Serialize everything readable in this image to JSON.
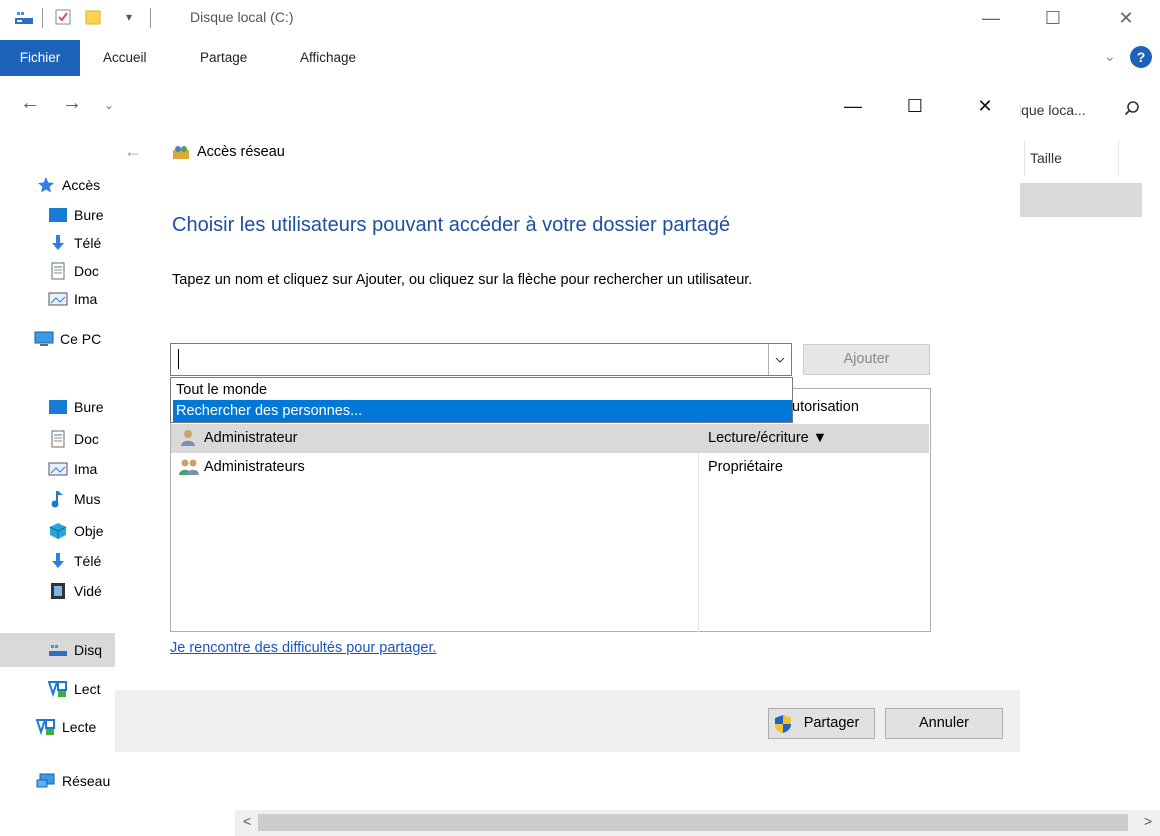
{
  "window": {
    "title": "Disque local (C:)",
    "controls": {
      "minimize": "—",
      "maximize": "☐",
      "close": "✕"
    }
  },
  "ribbon": {
    "tabs": [
      "Fichier",
      "Accueil",
      "Partage",
      "Affichage"
    ],
    "help": "?",
    "expand": "⌄"
  },
  "navbar": {
    "search_text": "ique loca...",
    "back": "←",
    "forward": "→",
    "recent": "⌄"
  },
  "sidebar": {
    "items": [
      {
        "label": "Accès",
        "icon": "star-icon"
      },
      {
        "label": "Bure",
        "icon": "desktop-icon"
      },
      {
        "label": "Télé",
        "icon": "download-icon"
      },
      {
        "label": "Doc",
        "icon": "document-icon"
      },
      {
        "label": "Ima",
        "icon": "pictures-icon"
      },
      {
        "label": "Ce PC",
        "icon": "computer-icon"
      },
      {
        "label": "Bure",
        "icon": "desktop-icon"
      },
      {
        "label": "Doc",
        "icon": "document-icon"
      },
      {
        "label": "Ima",
        "icon": "pictures-icon"
      },
      {
        "label": "Mus",
        "icon": "music-icon"
      },
      {
        "label": "Obje",
        "icon": "3d-objects-icon"
      },
      {
        "label": "Télé",
        "icon": "download-icon"
      },
      {
        "label": "Vidé",
        "icon": "video-icon"
      },
      {
        "label": "Disq",
        "icon": "drive-icon"
      },
      {
        "label": "Lect",
        "icon": "network-drive-icon"
      },
      {
        "label": "Lecte",
        "icon": "network-drive-icon"
      },
      {
        "label": "Réseau",
        "icon": "network-icon"
      }
    ]
  },
  "filelist": {
    "column_size": "Taille"
  },
  "dialog": {
    "title": "Accès réseau",
    "heading": "Choisir les utilisateurs pouvant accéder à votre dossier partagé",
    "instruction": "Tapez un nom et cliquez sur Ajouter, ou cliquez sur la flèche pour rechercher un utilisateur.",
    "input_value": "",
    "add_button": "Ajouter",
    "dropdown_options": [
      "Tout le monde",
      "Rechercher des personnes..."
    ],
    "table": {
      "header_permission_partial": "utorisation",
      "rows": [
        {
          "name": "Administrateur",
          "permission": "Lecture/écriture ▼"
        },
        {
          "name": "Administrateurs",
          "permission": "Propriétaire"
        }
      ]
    },
    "help_link": "Je rencontre des difficultés pour partager.",
    "share_button": "Partager",
    "cancel_button": "Annuler",
    "controls": {
      "minimize": "—",
      "maximize": "☐",
      "close": "✕"
    }
  },
  "scrollbar": {
    "left": "<",
    "right": ">"
  },
  "colors": {
    "accent": "#1c62b9",
    "heading": "#1f4fa0",
    "selection": "#0078d7",
    "link": "#1a55c4"
  }
}
